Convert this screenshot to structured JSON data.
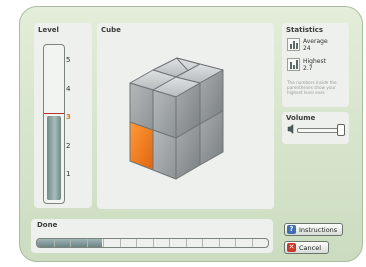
{
  "panels": {
    "level_title": "Level",
    "cube_title": "Cube",
    "statistics_title": "Statistics",
    "volume_title": "Volume",
    "done_title": "Done"
  },
  "level": {
    "ticks": [
      "5",
      "4",
      "3",
      "2",
      "1"
    ],
    "current": "3",
    "fill_fraction": 0.55
  },
  "statistics": {
    "average_label": "Average",
    "average_value": "24",
    "highest_label": "Highest",
    "highest_value": "2.7",
    "note": "The numbers inside the parentheses show your highest level ever."
  },
  "volume": {
    "level_fraction": 1.0
  },
  "done": {
    "progress_fraction": 0.28
  },
  "buttons": {
    "instructions": "Instructions",
    "cancel": "Cancel"
  },
  "colors": {
    "frame": "#d7e5cc",
    "highlight_cube": "#f07b1a",
    "cube_gray": "#9ea3a4"
  },
  "icons": {
    "instructions": "question-icon",
    "cancel": "x-icon"
  }
}
